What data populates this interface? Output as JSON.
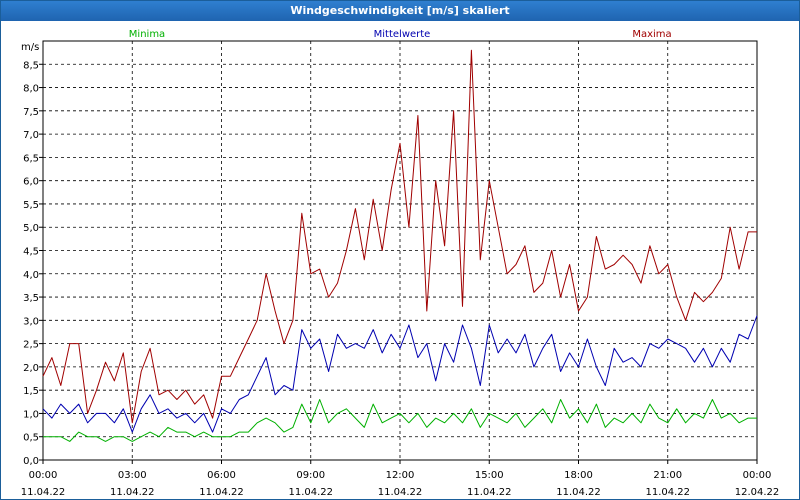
{
  "window": {
    "title": "Windgeschwindigkeit [m/s] skaliert"
  },
  "legend": {
    "minima": {
      "label": "Minima",
      "color": "#00b000"
    },
    "mittel": {
      "label": "Mittelwerte",
      "color": "#0000b0"
    },
    "maxima": {
      "label": "Maxima",
      "color": "#a00000"
    }
  },
  "chart_data": {
    "type": "line",
    "title": "Windgeschwindigkeit [m/s] skaliert",
    "ylabel": "m/s",
    "xlabel": "",
    "ylim": [
      0,
      9.0
    ],
    "xlim": [
      0,
      24
    ],
    "y_ticks": [
      "0,0",
      "0,5",
      "1,0",
      "1,5",
      "2,0",
      "2,5",
      "3,0",
      "3,5",
      "4,0",
      "4,5",
      "5,0",
      "5,5",
      "6,0",
      "6,5",
      "7,0",
      "7,5",
      "8,0",
      "8,5"
    ],
    "x_ticks": [
      {
        "time": "00:00",
        "date": "11.04.22"
      },
      {
        "time": "03:00",
        "date": "11.04.22"
      },
      {
        "time": "06:00",
        "date": "11.04.22"
      },
      {
        "time": "09:00",
        "date": "11.04.22"
      },
      {
        "time": "12:00",
        "date": "11.04.22"
      },
      {
        "time": "15:00",
        "date": "11.04.22"
      },
      {
        "time": "18:00",
        "date": "11.04.22"
      },
      {
        "time": "21:00",
        "date": "11.04.22"
      },
      {
        "time": "00:00",
        "date": "12.04.22"
      }
    ],
    "grid": true,
    "legend_placement": "top",
    "series": [
      {
        "name": "Maxima",
        "color": "#a00000",
        "x": [
          0,
          0.3,
          0.6,
          0.9,
          1.2,
          1.5,
          1.8,
          2.1,
          2.4,
          2.7,
          3.0,
          3.3,
          3.6,
          3.9,
          4.2,
          4.5,
          4.8,
          5.1,
          5.4,
          5.7,
          6.0,
          6.3,
          6.6,
          6.9,
          7.2,
          7.5,
          7.8,
          8.1,
          8.4,
          8.7,
          9.0,
          9.3,
          9.6,
          9.9,
          10.2,
          10.5,
          10.8,
          11.1,
          11.4,
          11.7,
          12.0,
          12.3,
          12.6,
          12.9,
          13.2,
          13.5,
          13.8,
          14.1,
          14.4,
          14.7,
          15.0,
          15.3,
          15.6,
          15.9,
          16.2,
          16.5,
          16.8,
          17.1,
          17.4,
          17.7,
          18.0,
          18.3,
          18.6,
          18.9,
          19.2,
          19.5,
          19.8,
          20.1,
          20.4,
          20.7,
          21.0,
          21.3,
          21.6,
          21.9,
          22.2,
          22.5,
          22.8,
          23.1,
          23.4,
          23.7,
          24.0
        ],
        "values": [
          1.8,
          2.2,
          1.6,
          2.5,
          2.5,
          1.0,
          1.5,
          2.1,
          1.7,
          2.3,
          0.8,
          1.9,
          2.4,
          1.4,
          1.5,
          1.3,
          1.5,
          1.2,
          1.4,
          0.9,
          1.8,
          1.8,
          2.2,
          2.6,
          3.0,
          4.0,
          3.2,
          2.5,
          3.0,
          5.3,
          4.0,
          4.1,
          3.5,
          3.8,
          4.5,
          5.4,
          4.3,
          5.6,
          4.5,
          5.8,
          6.8,
          5.0,
          7.4,
          3.2,
          6.0,
          4.6,
          7.5,
          3.3,
          8.8,
          4.3,
          6.0,
          5.0,
          4.0,
          4.2,
          4.6,
          3.6,
          3.8,
          4.5,
          3.5,
          4.2,
          3.2,
          3.5,
          4.8,
          4.1,
          4.2,
          4.4,
          4.2,
          3.8,
          4.6,
          4.0,
          4.2,
          3.5,
          3.0,
          3.6,
          3.4,
          3.6,
          3.9,
          5.0,
          4.1,
          4.9,
          4.9
        ]
      },
      {
        "name": "Mittelwerte",
        "color": "#0000b0",
        "x": [
          0,
          0.3,
          0.6,
          0.9,
          1.2,
          1.5,
          1.8,
          2.1,
          2.4,
          2.7,
          3.0,
          3.3,
          3.6,
          3.9,
          4.2,
          4.5,
          4.8,
          5.1,
          5.4,
          5.7,
          6.0,
          6.3,
          6.6,
          6.9,
          7.2,
          7.5,
          7.8,
          8.1,
          8.4,
          8.7,
          9.0,
          9.3,
          9.6,
          9.9,
          10.2,
          10.5,
          10.8,
          11.1,
          11.4,
          11.7,
          12.0,
          12.3,
          12.6,
          12.9,
          13.2,
          13.5,
          13.8,
          14.1,
          14.4,
          14.7,
          15.0,
          15.3,
          15.6,
          15.9,
          16.2,
          16.5,
          16.8,
          17.1,
          17.4,
          17.7,
          18.0,
          18.3,
          18.6,
          18.9,
          19.2,
          19.5,
          19.8,
          20.1,
          20.4,
          20.7,
          21.0,
          21.3,
          21.6,
          21.9,
          22.2,
          22.5,
          22.8,
          23.1,
          23.4,
          23.7,
          24.0
        ],
        "values": [
          1.1,
          0.9,
          1.2,
          1.0,
          1.2,
          0.8,
          1.0,
          1.0,
          0.8,
          1.1,
          0.6,
          1.1,
          1.4,
          1.0,
          1.1,
          0.9,
          1.0,
          0.8,
          1.0,
          0.6,
          1.1,
          1.0,
          1.3,
          1.4,
          1.8,
          2.2,
          1.4,
          1.6,
          1.5,
          2.8,
          2.4,
          2.6,
          1.9,
          2.7,
          2.4,
          2.5,
          2.4,
          2.8,
          2.3,
          2.7,
          2.4,
          2.9,
          2.2,
          2.5,
          1.7,
          2.5,
          2.1,
          2.9,
          2.4,
          1.6,
          2.9,
          2.3,
          2.6,
          2.3,
          2.7,
          2.0,
          2.4,
          2.7,
          1.9,
          2.3,
          2.0,
          2.6,
          2.0,
          1.6,
          2.4,
          2.1,
          2.2,
          2.0,
          2.5,
          2.4,
          2.6,
          2.5,
          2.4,
          2.1,
          2.4,
          2.0,
          2.4,
          2.1,
          2.7,
          2.6,
          3.1
        ]
      },
      {
        "name": "Minima",
        "color": "#00b000",
        "x": [
          0,
          0.3,
          0.6,
          0.9,
          1.2,
          1.5,
          1.8,
          2.1,
          2.4,
          2.7,
          3.0,
          3.3,
          3.6,
          3.9,
          4.2,
          4.5,
          4.8,
          5.1,
          5.4,
          5.7,
          6.0,
          6.3,
          6.6,
          6.9,
          7.2,
          7.5,
          7.8,
          8.1,
          8.4,
          8.7,
          9.0,
          9.3,
          9.6,
          9.9,
          10.2,
          10.5,
          10.8,
          11.1,
          11.4,
          11.7,
          12.0,
          12.3,
          12.6,
          12.9,
          13.2,
          13.5,
          13.8,
          14.1,
          14.4,
          14.7,
          15.0,
          15.3,
          15.6,
          15.9,
          16.2,
          16.5,
          16.8,
          17.1,
          17.4,
          17.7,
          18.0,
          18.3,
          18.6,
          18.9,
          19.2,
          19.5,
          19.8,
          20.1,
          20.4,
          20.7,
          21.0,
          21.3,
          21.6,
          21.9,
          22.2,
          22.5,
          22.8,
          23.1,
          23.4,
          23.7,
          24.0
        ],
        "values": [
          0.5,
          0.5,
          0.5,
          0.4,
          0.6,
          0.5,
          0.5,
          0.4,
          0.5,
          0.5,
          0.4,
          0.5,
          0.6,
          0.5,
          0.7,
          0.6,
          0.6,
          0.5,
          0.6,
          0.5,
          0.5,
          0.5,
          0.6,
          0.6,
          0.8,
          0.9,
          0.8,
          0.6,
          0.7,
          1.2,
          0.8,
          1.3,
          0.8,
          1.0,
          1.1,
          0.9,
          0.7,
          1.2,
          0.8,
          0.9,
          1.0,
          0.8,
          1.0,
          0.7,
          0.9,
          0.8,
          1.0,
          0.8,
          1.1,
          0.7,
          1.0,
          0.9,
          0.8,
          1.0,
          0.7,
          0.9,
          1.1,
          0.8,
          1.3,
          0.9,
          1.1,
          0.8,
          1.2,
          0.7,
          0.9,
          0.8,
          1.0,
          0.8,
          1.2,
          0.9,
          0.8,
          1.1,
          0.8,
          1.0,
          0.9,
          1.3,
          0.9,
          1.0,
          0.8,
          0.9,
          0.9
        ]
      }
    ]
  }
}
